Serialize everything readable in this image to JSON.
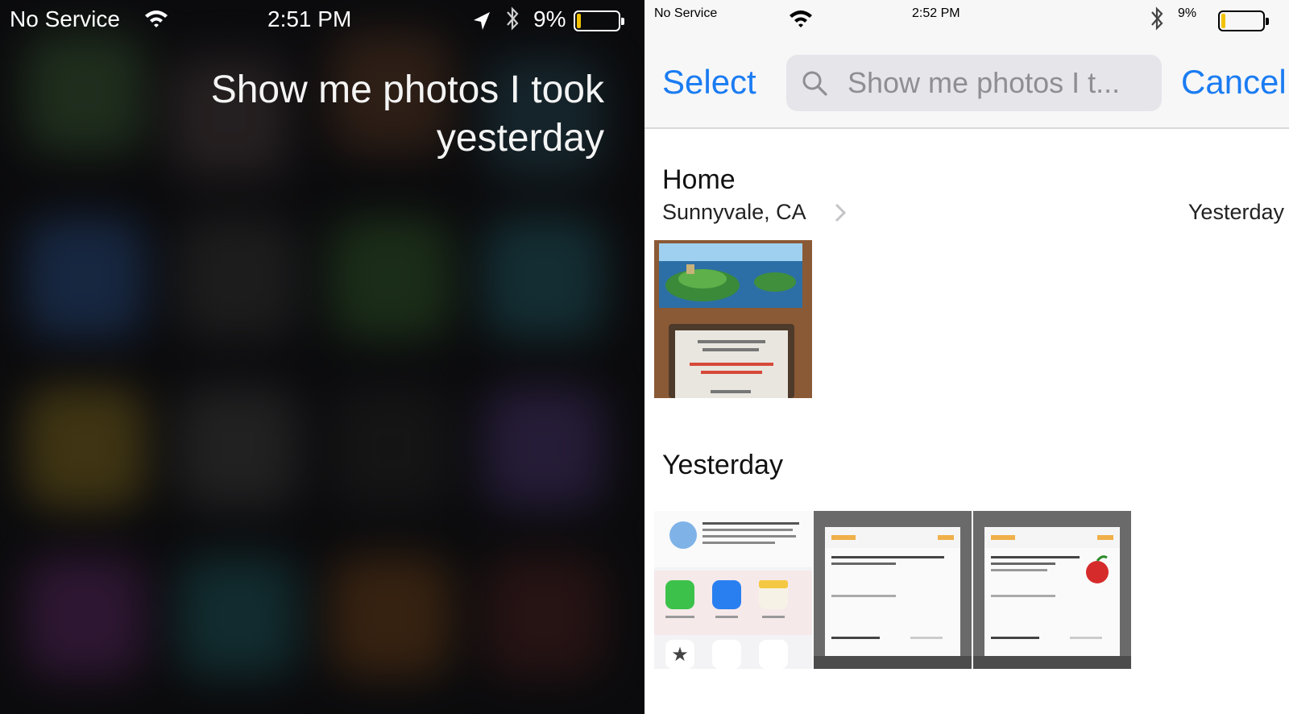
{
  "siri_screen": {
    "status": {
      "carrier": "No Service",
      "time": "2:51 PM",
      "battery": "9%"
    },
    "query": "Show me photos I took\nyesterday"
  },
  "photos_screen": {
    "status": {
      "carrier": "No Service",
      "time": "2:52 PM",
      "battery": "9%"
    },
    "select_label": "Select",
    "search_text": "Show me photos I t...",
    "cancel_label": "Cancel",
    "sections": [
      {
        "title": "Home",
        "subtitle": "Sunnyvale, CA",
        "date": "Yesterday"
      },
      {
        "title": "Yesterday"
      }
    ]
  },
  "colors": {
    "accent": "#1b7cf2",
    "battery_low": "#f2c200"
  },
  "icons": [
    "wifi-icon",
    "location-arrow-icon",
    "bluetooth-icon",
    "battery-icon",
    "search-icon",
    "chevron-right-icon"
  ]
}
